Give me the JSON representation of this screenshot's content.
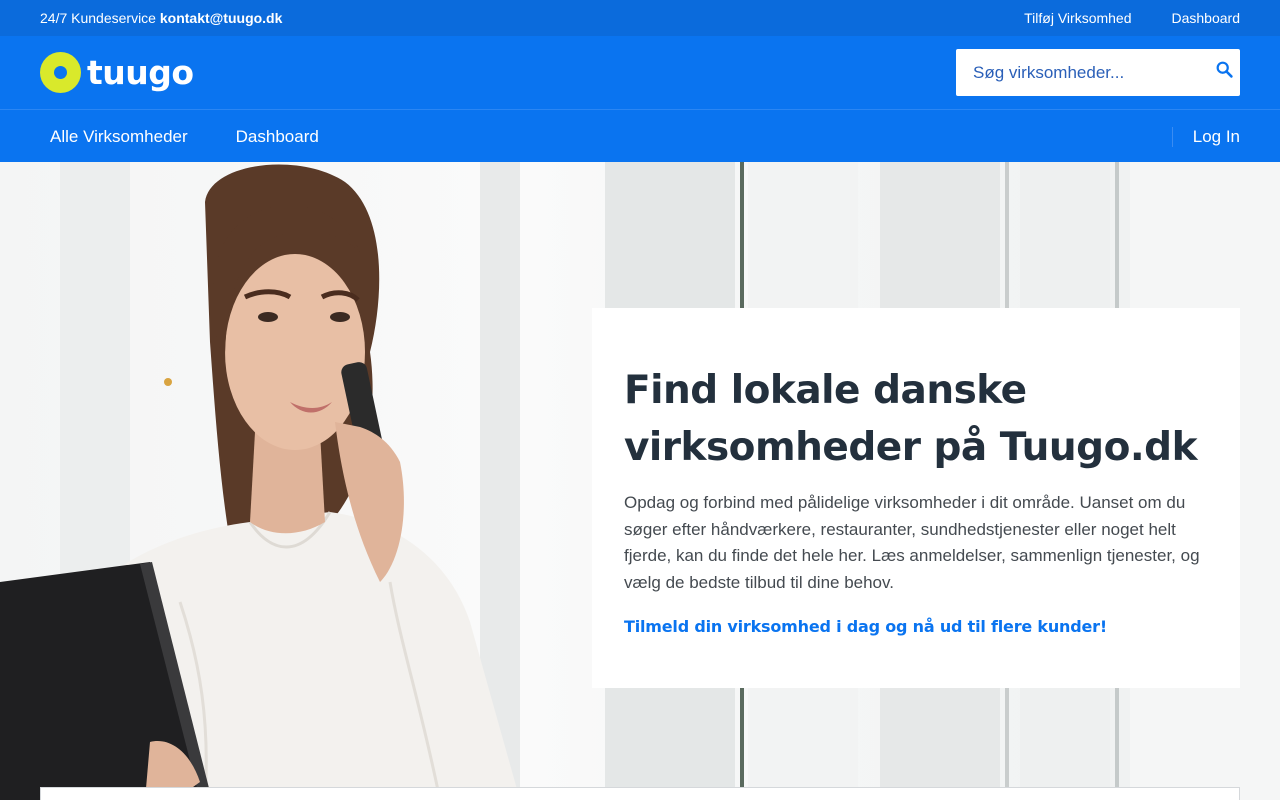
{
  "topbar": {
    "service_prefix": "24/7 Kundeservice ",
    "service_email": "kontakt@tuugo.dk",
    "link_add_business": "Tilføj Virksomhed",
    "link_dashboard": "Dashboard"
  },
  "header": {
    "logo_text": "tuugo",
    "search_placeholder": "Søg virksomheder...",
    "search_icon": "search-icon",
    "colors": {
      "brand_blue": "#0a74f0",
      "logo_yellow": "#d9e92b"
    }
  },
  "nav": {
    "items": [
      {
        "label": "Alle Virksomheder"
      },
      {
        "label": "Dashboard"
      }
    ],
    "login_label": "Log In"
  },
  "hero": {
    "title": "Find lokale danske virksomheder på Tuugo.dk",
    "description": "Opdag og forbind med pålidelige virksomheder i dit område. Uanset om du søger efter håndværkere, restauranter, sundhedstjenester eller noget helt fjerde, kan du finde det hele her. Læs anmeldelser, sammenlign tjenester, og vælg de bedste tilbud til dine behov.",
    "cta": "Tilmeld din virksomhed i dag og nå ud til flere kunder!"
  }
}
